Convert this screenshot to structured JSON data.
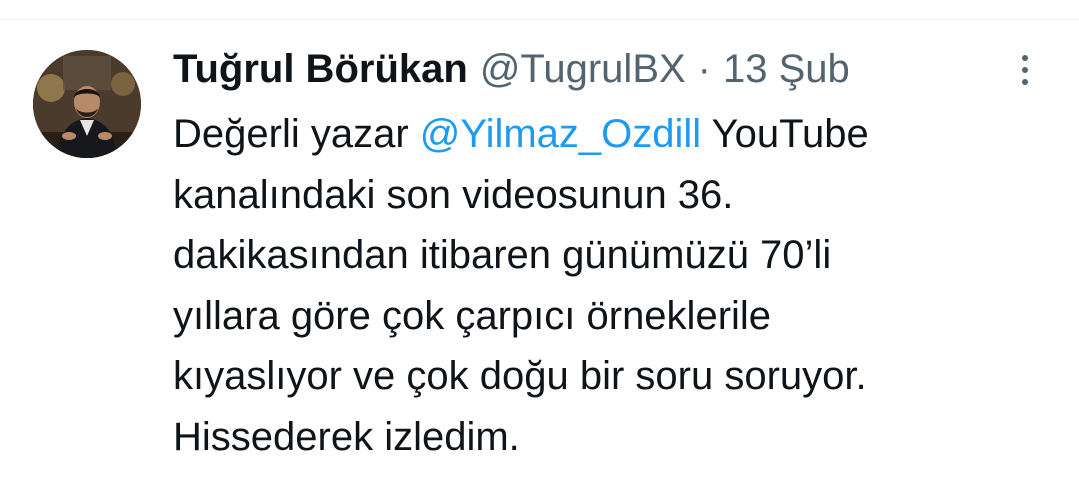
{
  "tweet": {
    "author": {
      "display_name": "Tuğrul Börükan",
      "handle": "@TugrulBX"
    },
    "separator": "·",
    "date": "13 Şub",
    "more_icon": "more-vertical-icon",
    "text": {
      "line1_prefix": "Değerli yazar ",
      "mention": "@Yilmaz_Ozdill",
      "line1_suffix": " YouTube",
      "line2": "kanalındaki son videosunun 36.",
      "line3": "dakikasından itibaren günümüzü 70’li",
      "line4": "yıllara göre çok çarpıcı örneklerile",
      "line5": "kıyaslıyor ve çok doğu bir soru soruyor.",
      "line6": "Hissederek izledim."
    }
  },
  "colors": {
    "text": "#0f1419",
    "secondary": "#536471",
    "link": "#1d9bf0",
    "divider": "#eff3f4"
  }
}
